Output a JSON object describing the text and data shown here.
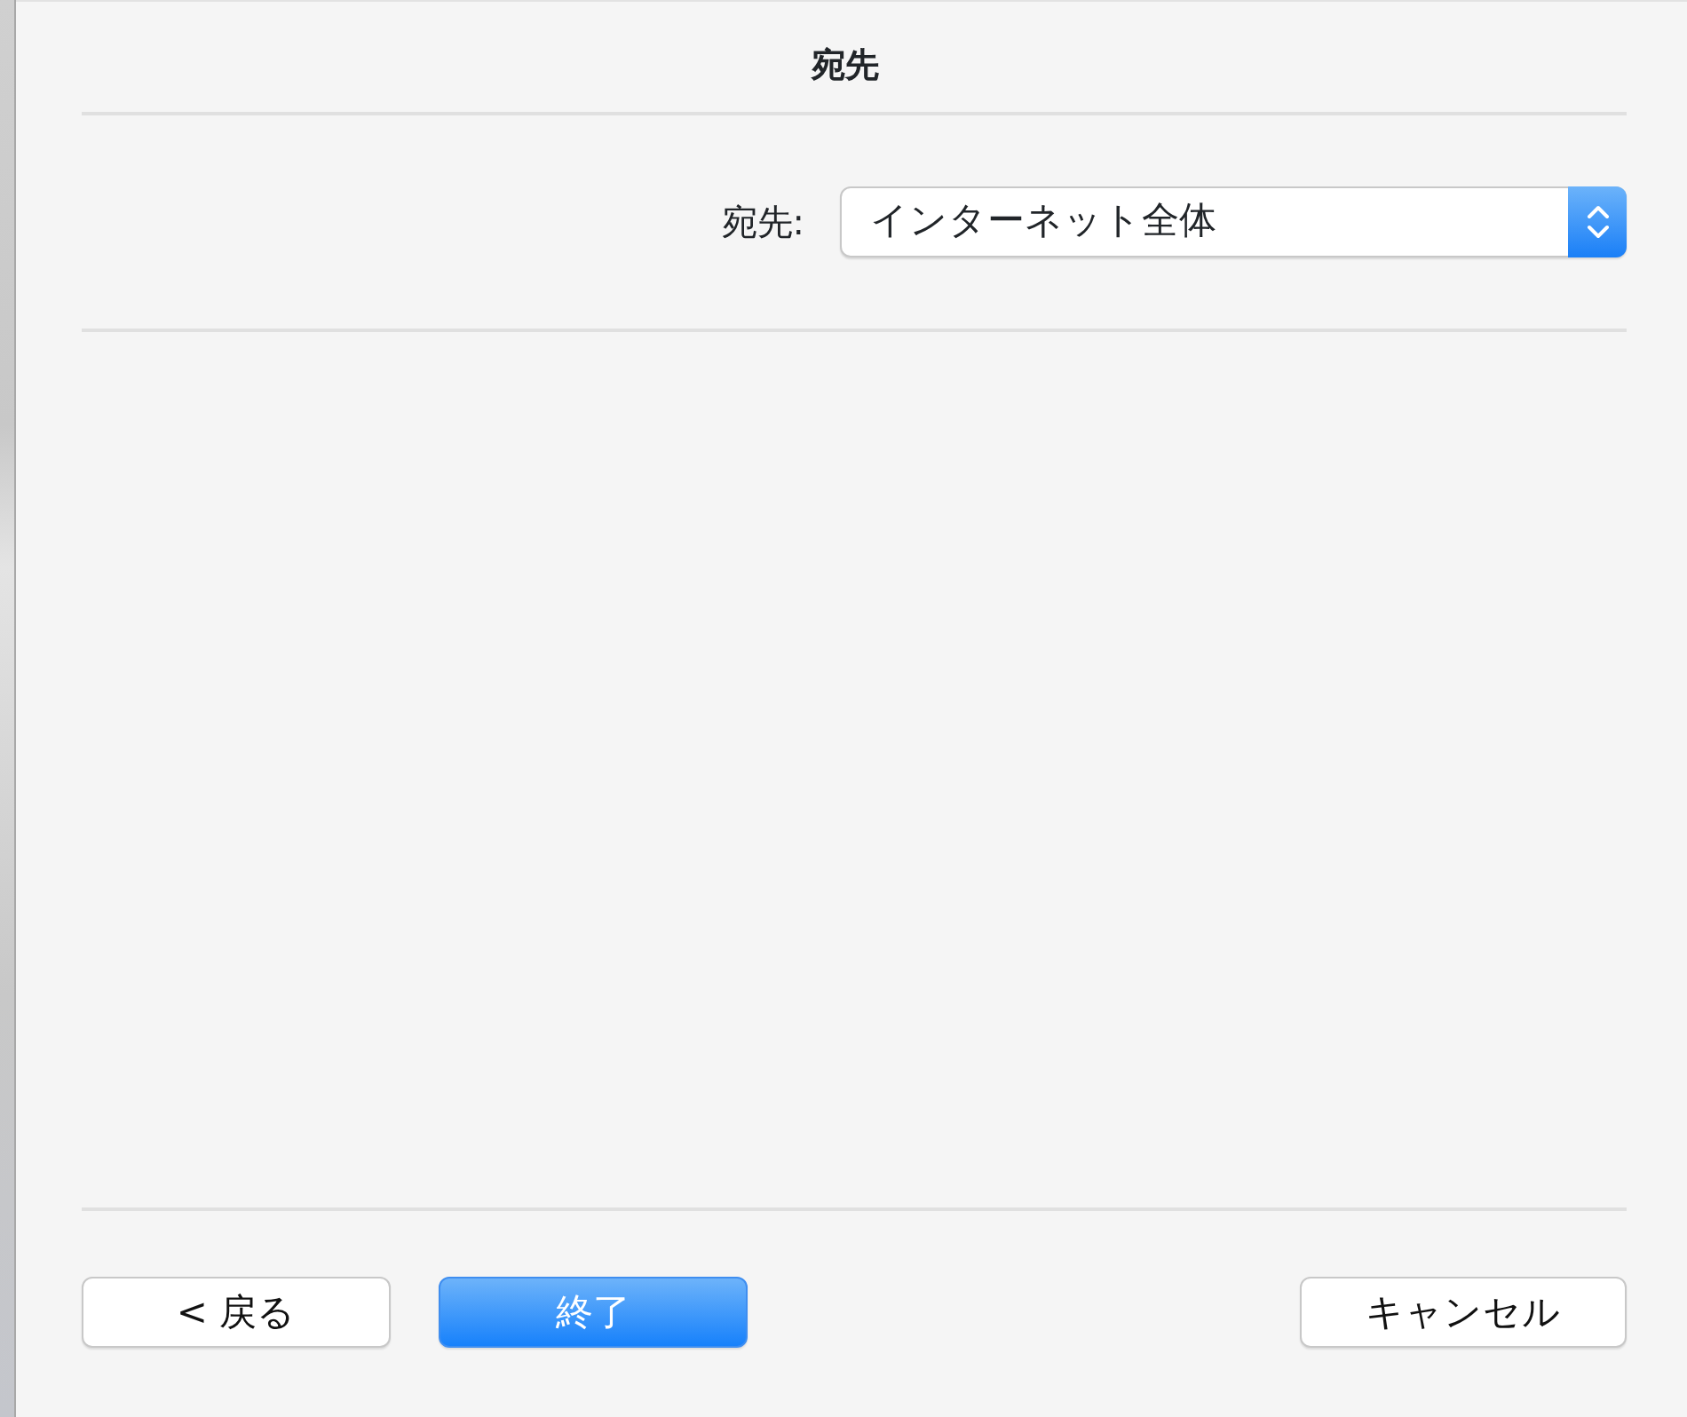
{
  "sheet": {
    "title": "宛先"
  },
  "destination": {
    "label": "宛先:",
    "value": "インターネット全体"
  },
  "left_buttons": [
    {
      "label": "< 戻る",
      "default": false
    },
    {
      "label": "終了",
      "default": true
    }
  ],
  "right_buttons": [
    {
      "label": "キャンセル",
      "default": false
    }
  ]
}
